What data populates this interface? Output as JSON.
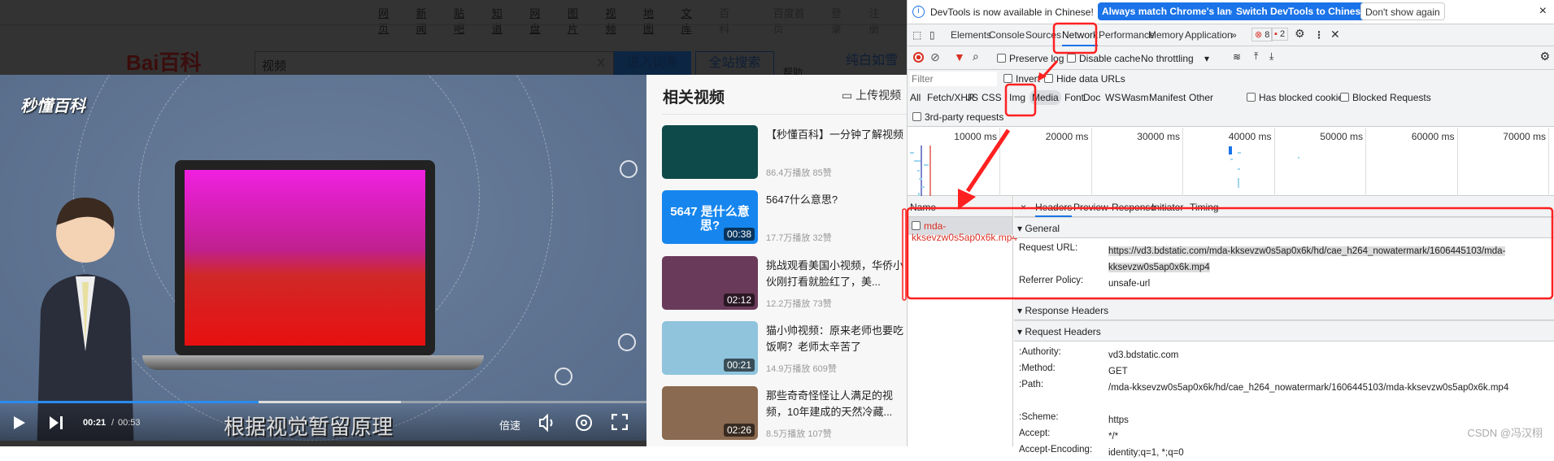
{
  "baidu": {
    "nav": [
      "网页",
      "新闻",
      "贴吧",
      "知道",
      "网盘",
      "图片",
      "视频",
      "地图",
      "文库"
    ],
    "nav_plain": [
      "百科",
      "百度首页",
      "登录",
      "注册"
    ],
    "logo": "Bai百科",
    "search_value": "视频",
    "clear": "X",
    "enter_button": "进入词条",
    "site_search_button": "全站搜索",
    "help": "帮助",
    "user": "纯白如雪"
  },
  "video": {
    "logo": "秒懂百科",
    "subtitle": "根据视觉暂留原理",
    "current_time": "00:21",
    "separator": "/",
    "duration": "00:53",
    "played_percent": 40,
    "buffered_percent": 62,
    "speed": "倍速"
  },
  "related": {
    "title": "相关视频",
    "upload": "上传视频",
    "items": [
      {
        "title": "【秒懂百科】一分钟了解视频",
        "meta": "86.4万播放  85赞",
        "duration": "",
        "color": "#0f4a4a"
      },
      {
        "title": "5647什么意思?",
        "meta": "17.7万播放  32赞",
        "duration": "00:38",
        "color": "#1686ee",
        "thumb_text": "5647 是什么意思?"
      },
      {
        "title": "挑战观看美国小视频，华侨小伙刚打看就脸红了，美...",
        "meta": "12.2万播放  73赞",
        "duration": "02:12",
        "color": "#6a3a5a"
      },
      {
        "title": "猫小帅视频：原来老师也要吃饭啊？老师太辛苦了",
        "meta": "14.9万播放  609赞",
        "duration": "00:21",
        "color": "#8fc4dc"
      },
      {
        "title": "那些奇奇怪怪让人满足的视频，10年建成的天然冷藏...",
        "meta": "8.5万播放  107赞",
        "duration": "02:26",
        "color": "#8a6a50"
      }
    ]
  },
  "devtools": {
    "info": {
      "text": "DevTools is now available in Chinese!",
      "btn1": "Always match Chrome's language",
      "btn2": "Switch DevTools to Chinese",
      "btn3": "Don't show again",
      "close": "×"
    },
    "tabs": [
      "Elements",
      "Console",
      "Sources",
      "Network",
      "Performance",
      "Memory",
      "Application"
    ],
    "active_tab": "Network",
    "more": "»",
    "errors": "8",
    "issues": "2",
    "toolbar": {
      "preserve_log": "Preserve log",
      "disable_cache": "Disable cache",
      "throttling": "No throttling"
    },
    "filter": {
      "placeholder": "Filter",
      "invert": "Invert",
      "hide_data_urls": "Hide data URLs"
    },
    "types": [
      "All",
      "Fetch/XHR",
      "JS",
      "CSS",
      "Img",
      "Media",
      "Font",
      "Doc",
      "WS",
      "Wasm",
      "Manifest",
      "Other"
    ],
    "active_type": "Media",
    "has_blocked_cookies": "Has blocked cookies",
    "blocked_requests": "Blocked Requests",
    "third_party": "3rd-party requests",
    "timeline_ticks": [
      "10000 ms",
      "20000 ms",
      "30000 ms",
      "40000 ms",
      "50000 ms",
      "60000 ms",
      "70000 ms"
    ],
    "name_header": "Name",
    "request_name": "mda-kksevzw0s5ap0x6k.mp4",
    "detail_tabs": [
      "Headers",
      "Preview",
      "Response",
      "Initiator",
      "Timing"
    ],
    "detail_close": "×",
    "general": {
      "title": "General",
      "request_url_label": "Request URL:",
      "request_url": "https://vd3.bdstatic.com/mda-kksevzw0s5ap0x6k/hd/cae_h264_nowatermark/1606445103/mda-kksevzw0s5ap0x6k.mp4",
      "referrer_label": "Referrer Policy:",
      "referrer": "unsafe-url"
    },
    "response_headers": "Response Headers",
    "request_headers": {
      "title": "Request Headers",
      "rows": [
        {
          "k": ":Authority:",
          "v": "vd3.bdstatic.com"
        },
        {
          "k": ":Method:",
          "v": "GET"
        },
        {
          "k": ":Path:",
          "v": "/mda-kksevzw0s5ap0x6k/hd/cae_h264_nowatermark/1606445103/mda-kksevzw0s5ap0x6k.mp4"
        },
        {
          "k": ":Scheme:",
          "v": "https"
        },
        {
          "k": "Accept:",
          "v": "*/*"
        },
        {
          "k": "Accept-Encoding:",
          "v": "identity;q=1, *;q=0"
        }
      ]
    }
  },
  "watermark": "CSDN @冯汉栩",
  "colors": {
    "accent": "#1a73e8",
    "annotation": "#ff2020",
    "error": "#d93025"
  }
}
